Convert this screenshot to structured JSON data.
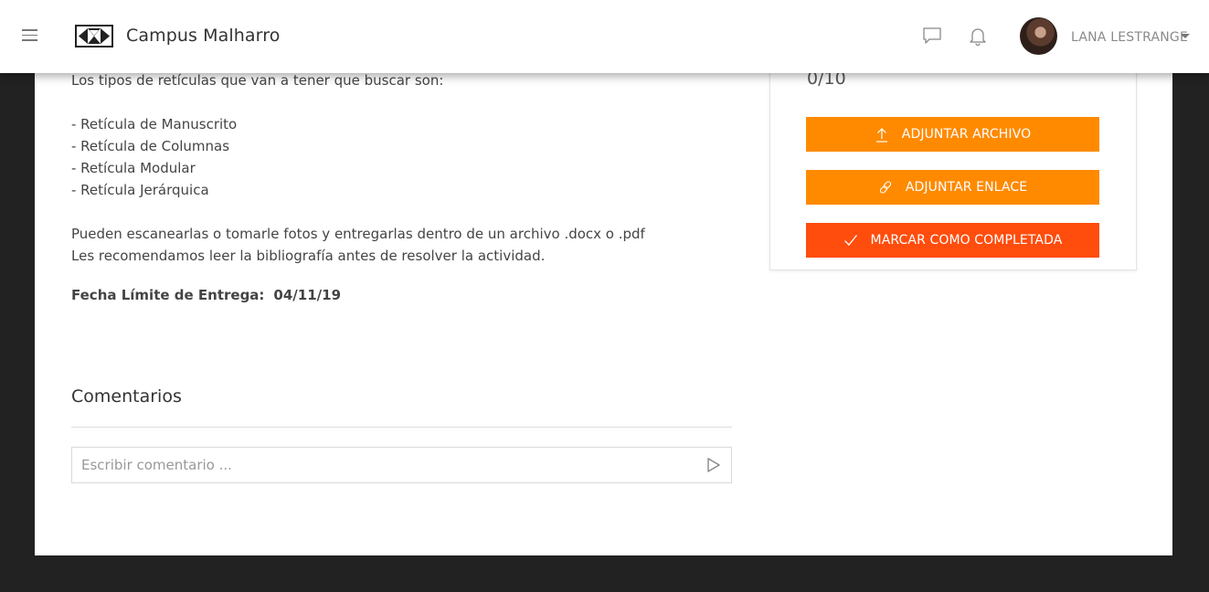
{
  "header": {
    "app_title": "Campus Malharro",
    "user_name": "LANA LESTRANGE",
    "icons": [
      "menu-icon",
      "logo",
      "chat-icon",
      "bell-icon",
      "avatar",
      "caret-down-icon"
    ]
  },
  "assignment": {
    "intro": "Los tipos de retículas que van a tener que buscar son:",
    "grid_types": [
      "- Retícula de Manuscrito",
      "- Retícula de Columnas",
      "- Retícula Modular",
      "- Retícula Jerárquica"
    ],
    "instructions": [
      "Pueden escanearlas o tomarle fotos y entregarlas dentro de un archivo .docx o .pdf",
      "Les recomendamos leer la bibliografía antes de resolver la actividad."
    ],
    "deadline_label": "Fecha Límite de Entrega:",
    "deadline_value": "04/11/19"
  },
  "comments": {
    "title": "Comentarios",
    "placeholder": "Escribir comentario ..."
  },
  "side_panel": {
    "score": "0/10",
    "attach_file_label": "ADJUNTAR ARCHIVO",
    "attach_link_label": "ADJUNTAR ENLACE",
    "mark_complete_label": "MARCAR COMO COMPLETADA"
  },
  "colors": {
    "accent_orange": "#ff8a00",
    "accent_red": "#ff4d0d",
    "background_dark": "#222222"
  }
}
